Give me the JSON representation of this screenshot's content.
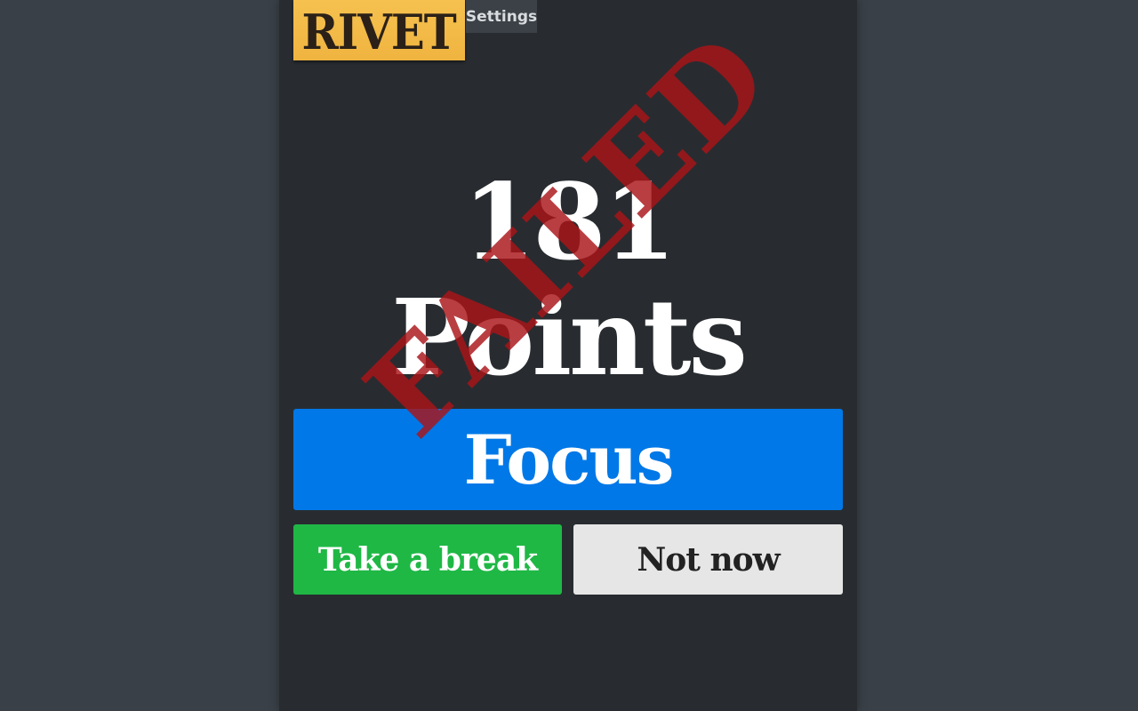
{
  "app": {
    "logo_text": "RIVET",
    "settings_label": "Settings"
  },
  "score": {
    "text": "181 Points",
    "stamp": "FAILED"
  },
  "actions": {
    "focus_label": "Focus",
    "break_label": "Take a break",
    "not_now_label": "Not now"
  },
  "colors": {
    "background": "#394047",
    "panel": "#282c30",
    "logo": "#f2b845",
    "focus": "#0078e7",
    "break": "#1fb845",
    "not_now": "#e6e6e6",
    "stamp": "#aa1418"
  }
}
